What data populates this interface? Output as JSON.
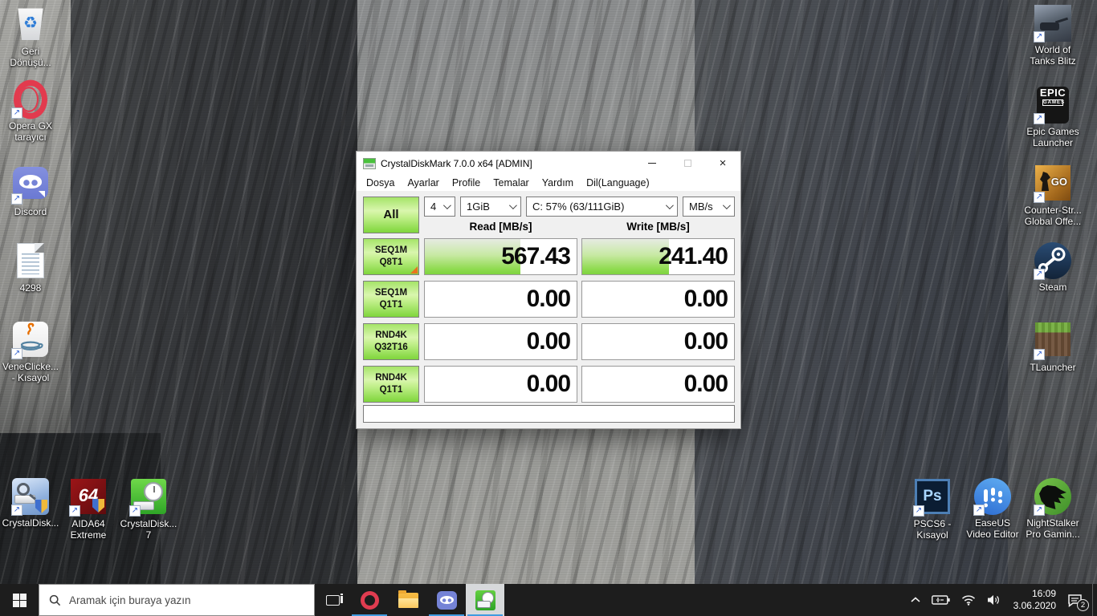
{
  "colors": {
    "accent_green": "#7ed33f",
    "taskbar_underline_blue": "#3f9be0",
    "marker_orange": "#e8731e",
    "taskbar_bg": "#1d1d1d",
    "titlebar_bg": "#ffffff"
  },
  "desktop": {
    "left_icons": [
      {
        "name": "recycle-bin",
        "label": "Geri Dönüşü...",
        "shortcut": false
      },
      {
        "name": "opera-gx",
        "label": "Opera GX tarayıcı",
        "shortcut": true
      },
      {
        "name": "discord",
        "label": "Discord",
        "shortcut": true
      },
      {
        "name": "text-document",
        "label": "4298",
        "shortcut": false
      },
      {
        "name": "java-app",
        "label": "VeneClicke... - Kısayol",
        "shortcut": true
      }
    ],
    "left_bottom_icons": [
      {
        "name": "crystaldiskinfo",
        "label": "CrystalDisk...",
        "shortcut": true
      },
      {
        "name": "aida64-extreme",
        "label": "AIDA64 Extreme",
        "shortcut": true
      },
      {
        "name": "crystaldiskmark-7",
        "label": "CrystalDisk... 7",
        "shortcut": true
      }
    ],
    "right_icons": [
      {
        "name": "world-of-tanks-blitz",
        "label": "World of Tanks Blitz",
        "shortcut": true
      },
      {
        "name": "epic-games-launcher",
        "label": "Epic Games Launcher",
        "shortcut": true
      },
      {
        "name": "csgo",
        "label": "Counter-Str... Global Offe...",
        "shortcut": true
      },
      {
        "name": "steam",
        "label": "Steam",
        "shortcut": true
      },
      {
        "name": "tlauncher",
        "label": "TLauncher",
        "shortcut": true
      }
    ],
    "right_bottom_icons": [
      {
        "name": "photoshop-cs6",
        "label": "PSCS6 - Kısayol",
        "shortcut": true
      },
      {
        "name": "easeus-video-editor",
        "label": "EaseUS Video Editor",
        "shortcut": true
      },
      {
        "name": "nightstalker",
        "label": "NightStalker Pro Gamin...",
        "shortcut": true
      }
    ]
  },
  "window": {
    "title": "CrystalDiskMark 7.0.0 x64 [ADMIN]",
    "menu": [
      "Dosya",
      "Ayarlar",
      "Profile",
      "Temalar",
      "Yardım",
      "Dil(Language)"
    ],
    "controls": {
      "all": "All",
      "test_count": "4",
      "test_size": "1GiB",
      "drive": "C: 57% (63/111GiB)",
      "unit": "MB/s"
    },
    "read_header": "Read [MB/s]",
    "write_header": "Write [MB/s]",
    "rows": [
      {
        "label_line1": "SEQ1M",
        "label_line2": "Q8T1",
        "read": "567.43",
        "write": "241.40",
        "read_fill": 0.63,
        "write_fill": 0.57
      },
      {
        "label_line1": "SEQ1M",
        "label_line2": "Q1T1",
        "read": "0.00",
        "write": "0.00",
        "read_fill": 0,
        "write_fill": 0
      },
      {
        "label_line1": "RND4K",
        "label_line2": "Q32T16",
        "read": "0.00",
        "write": "0.00",
        "read_fill": 0,
        "write_fill": 0
      },
      {
        "label_line1": "RND4K",
        "label_line2": "Q1T1",
        "read": "0.00",
        "write": "0.00",
        "read_fill": 0,
        "write_fill": 0
      }
    ],
    "status": ""
  },
  "taskbar": {
    "search_placeholder": "Aramak için buraya yazın",
    "tray": {
      "time": "16:09",
      "date": "3.06.2020",
      "notification_count": "2"
    }
  },
  "glyphs": {
    "recycle": "♻",
    "shortcut_arrow": "↗",
    "close": "×",
    "epic_line1": "EPIC",
    "epic_line2": "GAMES",
    "aida": "64",
    "photoshop": "Ps"
  }
}
